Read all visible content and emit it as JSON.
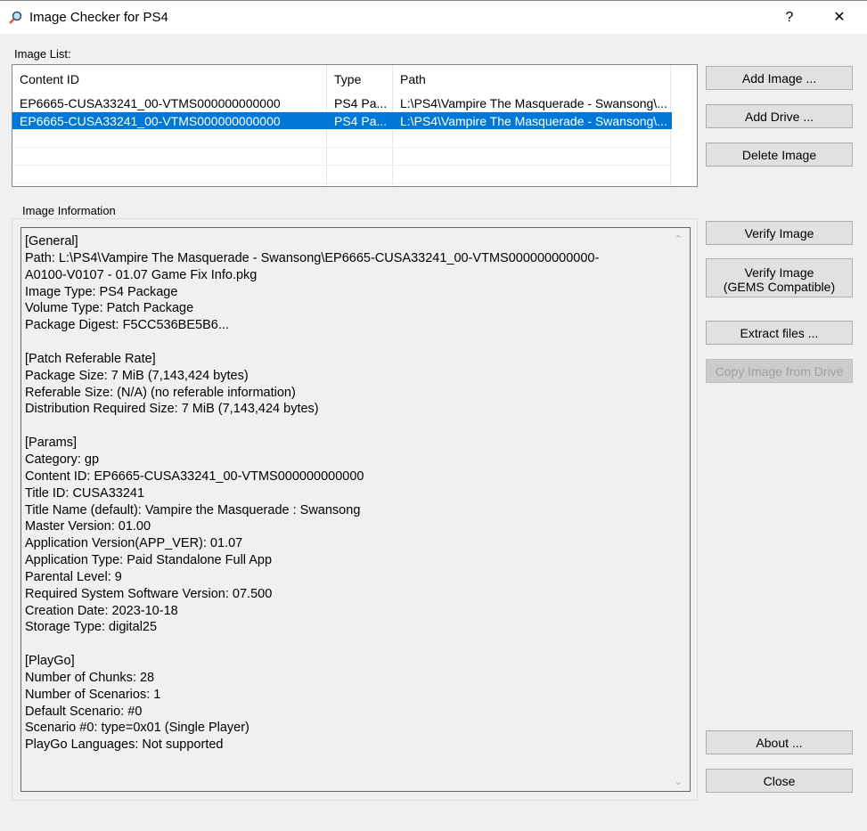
{
  "window": {
    "title": "Image Checker for PS4",
    "help": "?",
    "close": "✕"
  },
  "image_list": {
    "label": "Image List:",
    "columns": [
      "Content ID",
      "Type",
      "Path"
    ],
    "rows": [
      {
        "content_id": "EP6665-CUSA33241_00-VTMS000000000000",
        "type": "PS4 Pa...",
        "path": "L:\\PS4\\Vampire The Masquerade - Swansong\\...",
        "selected": false
      },
      {
        "content_id": "EP6665-CUSA33241_00-VTMS000000000000",
        "type": "PS4 Pa...",
        "path": "L:\\PS4\\Vampire The Masquerade - Swansong\\...",
        "selected": true
      }
    ]
  },
  "image_information": {
    "label": "Image Information",
    "lines": [
      "[General]",
      "Path: L:\\PS4\\Vampire The Masquerade - Swansong\\EP6665-CUSA33241_00-VTMS000000000000-",
      "A0100-V0107 - 01.07 Game Fix Info.pkg",
      "Image Type: PS4 Package",
      "Volume Type: Patch Package",
      "Package Digest: F5CC536BE5B6...",
      "",
      "[Patch Referable Rate]",
      "Package Size: 7 MiB (7,143,424 bytes)",
      "Referable Size: (N/A) (no referable information)",
      "Distribution Required Size: 7 MiB (7,143,424 bytes)",
      "",
      "[Params]",
      "Category: gp",
      "Content ID: EP6665-CUSA33241_00-VTMS000000000000",
      "Title ID: CUSA33241",
      "Title Name (default): Vampire the Masquerade : Swansong",
      "Master Version: 01.00",
      "Application Version(APP_VER): 01.07",
      "Application Type: Paid Standalone Full App",
      "Parental Level: 9",
      "Required System Software Version: 07.500",
      "Creation Date: 2023-10-18",
      "Storage Type: digital25",
      "",
      "[PlayGo]",
      "Number of Chunks: 28",
      "Number of Scenarios: 1",
      "Default Scenario: #0",
      "Scenario #0: type=0x01 (Single Player)",
      "PlayGo Languages: Not supported"
    ]
  },
  "buttons": {
    "add_image": "Add Image ...",
    "add_drive": "Add Drive ...",
    "delete_image": "Delete Image",
    "verify_image": "Verify Image",
    "verify_gems_1": "Verify Image",
    "verify_gems_2": "(GEMS Compatible)",
    "extract": "Extract files ...",
    "copy": "Copy Image from Drive",
    "about": "About ...",
    "close": "Close"
  }
}
